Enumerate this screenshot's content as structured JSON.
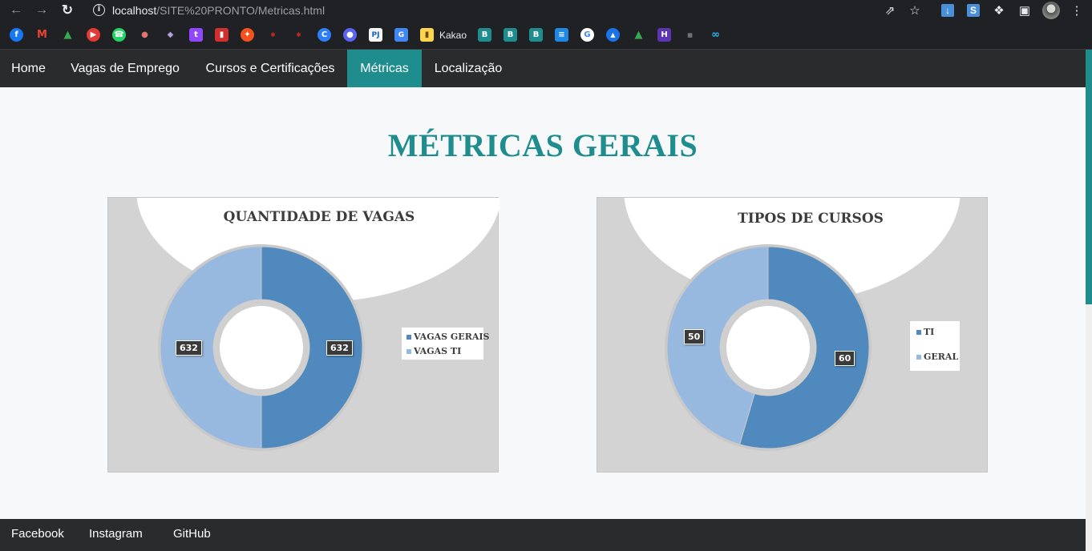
{
  "browser": {
    "url_host": "localhost",
    "url_path": "/SITE%20PRONTO/Metricas.html",
    "bookmark_label": "Kakao"
  },
  "nav": {
    "items": [
      {
        "label": "Home",
        "active": false
      },
      {
        "label": "Vagas de Emprego",
        "active": false
      },
      {
        "label": "Cursos e Certificações",
        "active": false
      },
      {
        "label": "Métricas",
        "active": true
      },
      {
        "label": "Localização",
        "active": false
      }
    ],
    "active_color": "#1f8d8e"
  },
  "page": {
    "title": "MÉTRICAS GERAIS",
    "title_color": "#1f8d8e"
  },
  "chart_data": [
    {
      "type": "pie",
      "variant": "donut",
      "title": "QUANTIDADE DE VAGAS",
      "categories": [
        "VAGAS GERAIS",
        "VAGAS TI"
      ],
      "values": [
        632,
        632
      ],
      "colors": [
        "#4f89bd",
        "#97b8df"
      ],
      "data_labels": [
        "632",
        "632"
      ],
      "legend": "right"
    },
    {
      "type": "pie",
      "variant": "donut",
      "title": "TIPOS DE CURSOS",
      "categories": [
        "TI",
        "GERAL"
      ],
      "values": [
        60,
        50
      ],
      "colors": [
        "#4f89bd",
        "#97b8df"
      ],
      "data_labels": [
        "60",
        "50"
      ],
      "legend": "right"
    }
  ],
  "footer": {
    "links": [
      "Facebook",
      "Instagram",
      "GitHub"
    ]
  }
}
